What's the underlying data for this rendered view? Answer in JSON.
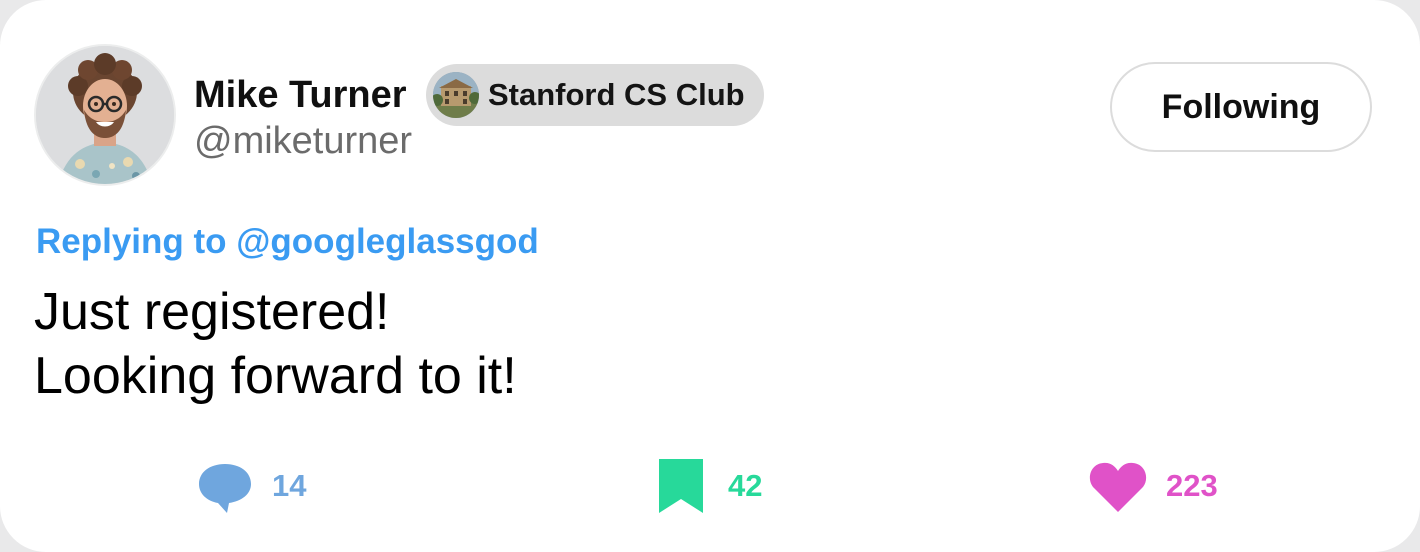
{
  "author": {
    "name": "Mike Turner",
    "handle": "@miketurner",
    "avatar_icon": "person-avatar"
  },
  "club_badge": {
    "label": "Stanford CS Club",
    "icon": "building-photo-icon"
  },
  "follow_button": {
    "label": "Following"
  },
  "reply": {
    "prefix": "Replying to",
    "mention": "@googleglassgod"
  },
  "post": {
    "lines": [
      "Just registered!",
      "Looking forward to it!"
    ]
  },
  "actions": {
    "comments": {
      "count": "14",
      "icon": "comment-bubble-icon",
      "color": "#6fa6de"
    },
    "bookmarks": {
      "count": "42",
      "icon": "bookmark-icon",
      "color": "#27d99a"
    },
    "likes": {
      "count": "223",
      "icon": "heart-icon",
      "color": "#e052c8"
    }
  },
  "colors": {
    "accent_link": "#3a9bf2",
    "card_background": "#ffffff",
    "badge_background": "#dcdcdc"
  }
}
